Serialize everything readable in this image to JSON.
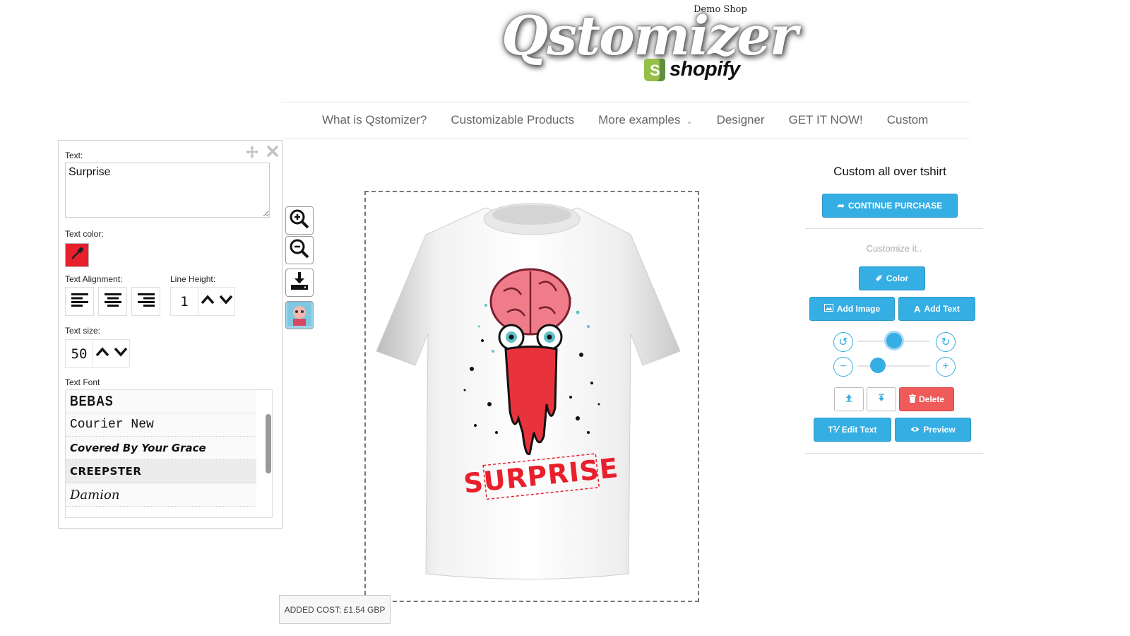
{
  "header": {
    "logo_text": "Qstomizer",
    "logo_demo": "Demo Shop",
    "shopify_text": "shopify"
  },
  "nav": {
    "items": [
      "What is Qstomizer?",
      "Customizable Products",
      "More examples",
      "Designer",
      "GET IT NOW!",
      "Custom"
    ]
  },
  "text_editor": {
    "text_label": "Text:",
    "text_value": "Surprise",
    "text_color_label": "Text color:",
    "text_color": "#e8202b",
    "alignment_label": "Text Alignment:",
    "line_height_label": "Line Height:",
    "line_height_value": "1",
    "text_size_label": "Text size:",
    "text_size_value": "50",
    "font_label": "Text Font",
    "fonts": [
      "BEBAS",
      "Courier New",
      "Covered By Your Grace",
      "CREEPSTER",
      "Damion"
    ],
    "selected_font": "CREEPSTER"
  },
  "canvas": {
    "design_text": "SURPRISE",
    "added_cost": "ADDED COST: £1.54 GBP"
  },
  "right_panel": {
    "product_title": "Custom all over tshirt",
    "continue_purchase": "CONTINUE PURCHASE",
    "customize_hint": "Customize it..",
    "color_button": "Color",
    "add_image_button": "Add Image",
    "add_text_button": "Add Text",
    "delete_button": "Delete",
    "edit_text_button": "Edit Text",
    "preview_button": "Preview"
  },
  "colors": {
    "accent": "#35aee3",
    "danger": "#ef5b5b",
    "text_red": "#e8202b"
  },
  "icons": [
    "move-icon",
    "close-icon",
    "eyedropper-icon",
    "align-left-icon",
    "align-center-icon",
    "align-right-icon",
    "chevron-up-icon",
    "chevron-down-icon",
    "zoom-in-icon",
    "zoom-out-icon",
    "download-icon",
    "avatar-icon",
    "share-icon",
    "brush-icon",
    "image-icon",
    "text-icon",
    "rotate-left-icon",
    "rotate-right-icon",
    "minus-icon",
    "plus-icon",
    "layer-up-icon",
    "layer-down-icon",
    "trash-icon",
    "eye-icon"
  ]
}
